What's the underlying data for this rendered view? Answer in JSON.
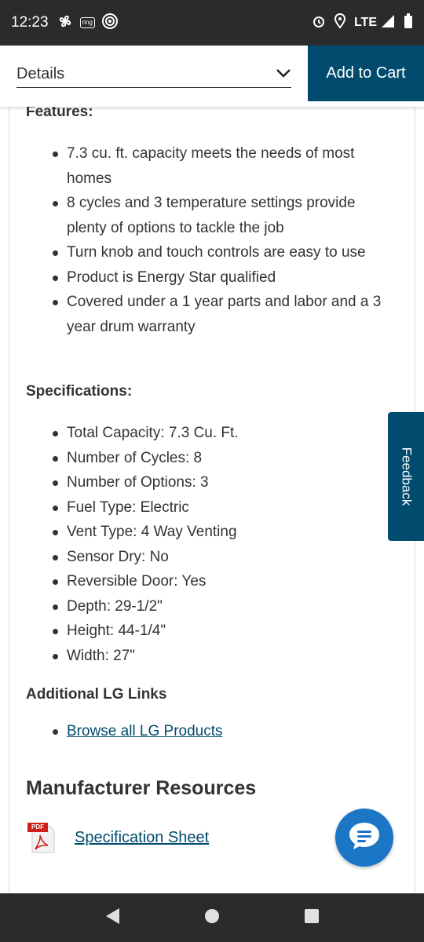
{
  "status_bar": {
    "time": "12:23",
    "ring_label": "ring",
    "network": "LTE",
    "icons": [
      "fan-icon",
      "ring-icon",
      "signal-broadcast-icon",
      "alarm-icon",
      "location-icon",
      "cell-signal-icon",
      "battery-icon"
    ]
  },
  "header": {
    "details_label": "Details",
    "add_to_cart_label": "Add to Cart"
  },
  "features": {
    "heading": "Features:",
    "items": [
      "7.3 cu. ft. capacity meets the needs of most homes",
      "8 cycles and 3 temperature settings provide plenty of options to tackle the job",
      "Turn knob and touch controls are easy to use",
      "Product is Energy Star qualified",
      "Covered under a 1 year parts and labor and a 3 year drum warranty"
    ]
  },
  "specifications": {
    "heading": "Specifications:",
    "items": [
      "Total Capacity: 7.3 Cu. Ft.",
      "Number of Cycles: 8",
      "Number of Options: 3",
      "Fuel Type: Electric",
      "Vent Type: 4 Way Venting",
      "Sensor Dry: No",
      "Reversible Door: Yes",
      "Depth: 29-1/2\"",
      "Height: 44-1/4\"",
      "Width: 27\""
    ]
  },
  "additional_links": {
    "heading": "Additional LG Links",
    "items": [
      "Browse all LG Products"
    ]
  },
  "resources": {
    "heading": "Manufacturer Resources",
    "pdf_badge": "PDF",
    "spec_sheet_label": "Specification Sheet"
  },
  "feedback": {
    "label": "Feedback"
  },
  "colors": {
    "brand_blue": "#004b6e",
    "chat_blue": "#1b76c6",
    "system_bar": "#2b2b2d"
  }
}
